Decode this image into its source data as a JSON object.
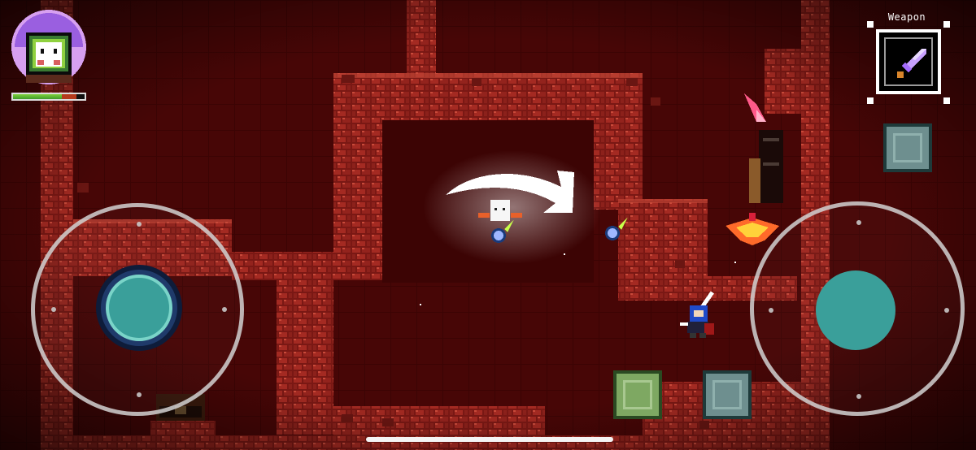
{
  "game": {
    "hud": {
      "player_health": 0.68,
      "weapon_label": "Weapon",
      "weapon_icon": "sword-icon"
    },
    "colors": {
      "wall": "#8a1e1a",
      "floor": "#4a0505",
      "floor_dark": "#320303",
      "joystick_knob": "#3a9f9a",
      "health_green": "#6cc83a",
      "health_red": "#b53a1c"
    },
    "entities": {
      "player": "knight-player",
      "enemies": [
        "flame-bird-enemy",
        "ghost-enemy",
        "skull-fireball",
        "skull-fireball",
        "skull-fireball"
      ]
    }
  }
}
